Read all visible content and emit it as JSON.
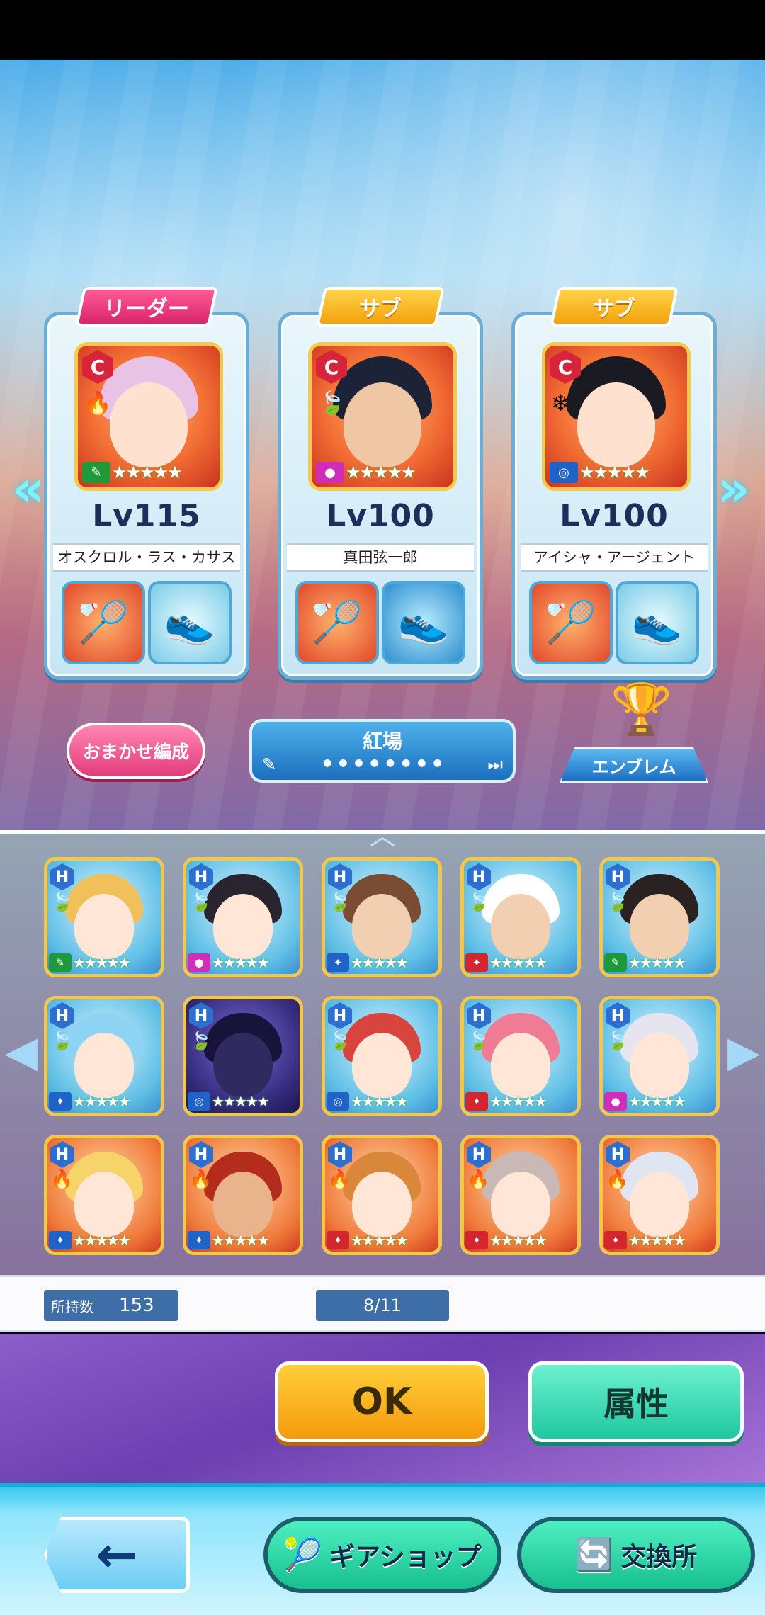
{
  "cards": [
    {
      "tag": "リーダー",
      "rank": "C",
      "level": "Lv115",
      "name": "オスクロル・ラス・カサス"
    },
    {
      "tag": "サブ",
      "rank": "C",
      "level": "Lv100",
      "name": "真田弦一郎"
    },
    {
      "tag": "サブ",
      "rank": "C",
      "level": "Lv100",
      "name": "アイシャ・アージェント"
    }
  ],
  "controls": {
    "auto_label": "おまかせ編成",
    "deck_name": "紅場",
    "emblem_label": "エンブレム"
  },
  "roster": {
    "rank_letter": "H",
    "owned_label": "所持数",
    "owned_value": "153",
    "slot_count": "8/11"
  },
  "actions": {
    "ok_label": "OK",
    "attribute_label": "属性"
  },
  "footer": {
    "back_icon": "←",
    "gear_shop_label": "ギアショップ",
    "exchange_label": "交換所"
  },
  "colors": {
    "leader_tag": "#e23c7b",
    "sub_tag": "#f2a20c",
    "ok": "#f59a0c",
    "attribute": "#1fc79f"
  }
}
